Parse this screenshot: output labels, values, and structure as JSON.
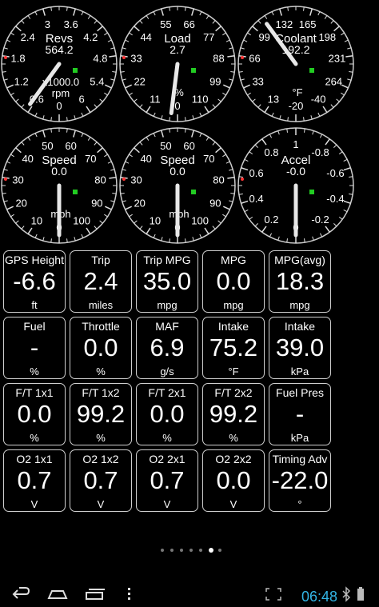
{
  "gauges": [
    {
      "label": "Revs",
      "value": "564.2",
      "unit": "x1000.0",
      "unit2": "rpm",
      "ticks": [
        "0",
        "0.6",
        "1.2",
        "1.8",
        "2.4",
        "3",
        "3.6",
        "4.2",
        "4.8",
        "5.4",
        "6"
      ],
      "needle_fraction": 0.1
    },
    {
      "label": "Load",
      "value": "2.7",
      "unit": "%",
      "ticks": [
        "0",
        "11",
        "22",
        "33",
        "44",
        "55",
        "66",
        "77",
        "88",
        "99",
        "110"
      ],
      "needle_fraction": 0.02
    },
    {
      "label": "Coolant",
      "value": "192.2",
      "unit": "°F",
      "ticks": [
        "-20",
        "13",
        "33",
        "66",
        "99",
        "132",
        "165",
        "198",
        "231",
        "264",
        "-40"
      ],
      "needle_fraction": 0.4
    },
    {
      "label": "Speed",
      "value": "0.0",
      "unit": "mph",
      "ticks": [
        "0",
        "10",
        "20",
        "30",
        "40",
        "50",
        "60",
        "70",
        "80",
        "90",
        "100"
      ],
      "needle_fraction": 0.0
    },
    {
      "label": "Speed",
      "value": "0.0",
      "unit": "mph",
      "ticks": [
        "0",
        "10",
        "20",
        "30",
        "40",
        "50",
        "60",
        "70",
        "80",
        "90",
        "100"
      ],
      "needle_fraction": 0.0
    },
    {
      "label": "Accel",
      "value": "-0.0",
      "unit": "",
      "ticks": [
        "0",
        "0.2",
        "0.4",
        "0.6",
        "0.8",
        "1",
        "-0.8",
        "-0.6",
        "-0.4",
        "-0.2"
      ],
      "needle_fraction": 0.0
    }
  ],
  "tiles": [
    {
      "label": "GPS Height",
      "value": "-6.6",
      "unit": "ft"
    },
    {
      "label": "Trip",
      "value": "2.4",
      "unit": "miles"
    },
    {
      "label": "Trip MPG",
      "value": "35.0",
      "unit": "mpg"
    },
    {
      "label": "MPG",
      "value": "0.0",
      "unit": "mpg"
    },
    {
      "label": "MPG(avg)",
      "value": "18.3",
      "unit": "mpg"
    },
    {
      "label": "Fuel",
      "value": "-",
      "unit": "%"
    },
    {
      "label": "Throttle",
      "value": "0.0",
      "unit": "%"
    },
    {
      "label": "MAF",
      "value": "6.9",
      "unit": "g/s"
    },
    {
      "label": "Intake",
      "value": "75.2",
      "unit": "°F"
    },
    {
      "label": "Intake",
      "value": "39.0",
      "unit": "kPa"
    },
    {
      "label": "F/T 1x1",
      "value": "0.0",
      "unit": "%"
    },
    {
      "label": "F/T 1x2",
      "value": "99.2",
      "unit": "%"
    },
    {
      "label": "F/T 2x1",
      "value": "0.0",
      "unit": "%"
    },
    {
      "label": "F/T 2x2",
      "value": "99.2",
      "unit": "%"
    },
    {
      "label": "Fuel Pres",
      "value": "-",
      "unit": "kPa"
    },
    {
      "label": "O2 1x1",
      "value": "0.7",
      "unit": "V"
    },
    {
      "label": "O2 1x2",
      "value": "0.7",
      "unit": "V"
    },
    {
      "label": "O2 2x1",
      "value": "0.7",
      "unit": "V"
    },
    {
      "label": "O2 2x2",
      "value": "0.0",
      "unit": "V"
    },
    {
      "label": "Timing Adv",
      "value": "-22.0",
      "unit": "°"
    }
  ],
  "pager": {
    "count": 7,
    "active": 5
  },
  "statusbar": {
    "time": "06:48"
  },
  "colors": {
    "clock": "#33b5e5",
    "gauge_face": "#000000",
    "gauge_rim": "#cccccc",
    "warning_tick": "#ff3333",
    "indicator": "#22cc22"
  },
  "icons": [
    "back-icon",
    "home-icon",
    "recent-apps-icon",
    "screenshot-icon",
    "bluetooth-icon",
    "battery-icon"
  ]
}
